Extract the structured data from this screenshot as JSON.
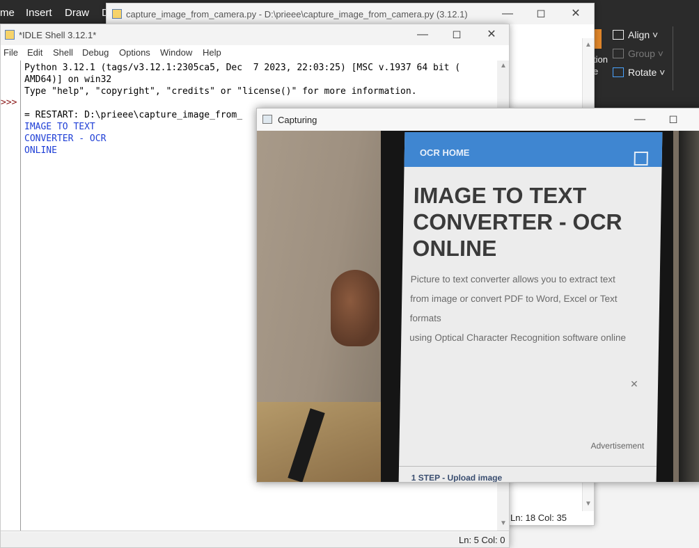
{
  "ribbon": {
    "tabs": [
      "me",
      "Insert",
      "Draw",
      "D"
    ],
    "align_label": "Align ˅",
    "group_label": "Group ˅",
    "rotate_label": "Rotate ˅",
    "partial_text_1": "tion",
    "partial_text_2": "e"
  },
  "editor": {
    "title": "capture_image_from_camera.py - D:\\prieee\\capture_image_from_camera.py (3.12.1)",
    "status": "Ln: 18   Col: 35"
  },
  "idle": {
    "title": "*IDLE Shell 3.12.1*",
    "menu": [
      "File",
      "Edit",
      "Shell",
      "Debug",
      "Options",
      "Window",
      "Help"
    ],
    "prompt": ">>>",
    "lines": [
      "Python 3.12.1 (tags/v3.12.1:2305ca5, Dec  7 2023, 22:03:25) [MSC v.1937 64 bit (",
      "AMD64)] on win32",
      "Type \"help\", \"copyright\", \"credits\" or \"license()\" for more information.",
      "",
      "= RESTART: D:\\prieee\\capture_image_from_"
    ],
    "output_lines": [
      "IMAGE TO TEXT",
      "CONVERTER - OCR",
      "ONLINE"
    ],
    "status": "Ln: 5   Col: 0"
  },
  "capture": {
    "title": "Capturing",
    "screen": {
      "appbar_title": "OCR HOME",
      "headline": [
        "IMAGE TO TEXT",
        "CONVERTER - OCR",
        "ONLINE"
      ],
      "body": [
        "Picture to text converter allows you to extract text",
        "from image or convert PDF to Word, Excel or Text",
        "formats",
        "using Optical Character Recognition software online"
      ],
      "close_glyph": "✕",
      "advertisement": "Advertisement",
      "step": "1 STEP - Upload image"
    }
  }
}
